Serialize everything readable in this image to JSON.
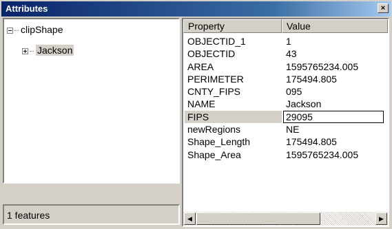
{
  "window": {
    "title": "Attributes",
    "close_glyph": "×"
  },
  "tree": {
    "root_label": "clipShape",
    "child_label": "Jackson"
  },
  "status": {
    "text": "1 features"
  },
  "grid": {
    "headers": {
      "property": "Property",
      "value": "Value"
    },
    "rows": [
      {
        "name": "OBJECTID_1",
        "value": "1"
      },
      {
        "name": "OBJECTID",
        "value": "43"
      },
      {
        "name": "AREA",
        "value": "1595765234.005"
      },
      {
        "name": "PERIMETER",
        "value": "175494.805"
      },
      {
        "name": "CNTY_FIPS",
        "value": "095"
      },
      {
        "name": "NAME",
        "value": "Jackson"
      },
      {
        "name": "FIPS",
        "value": "29095"
      },
      {
        "name": "newRegions",
        "value": "NE"
      },
      {
        "name": "Shape_Length",
        "value": "175494.805"
      },
      {
        "name": "Shape_Area",
        "value": "1595765234.005"
      }
    ],
    "selected_row": "FIPS"
  },
  "scrollbar": {
    "left_glyph": "◀",
    "right_glyph": "▶"
  },
  "colors": {
    "title_start": "#0a246a",
    "face": "#d4d0c8"
  }
}
